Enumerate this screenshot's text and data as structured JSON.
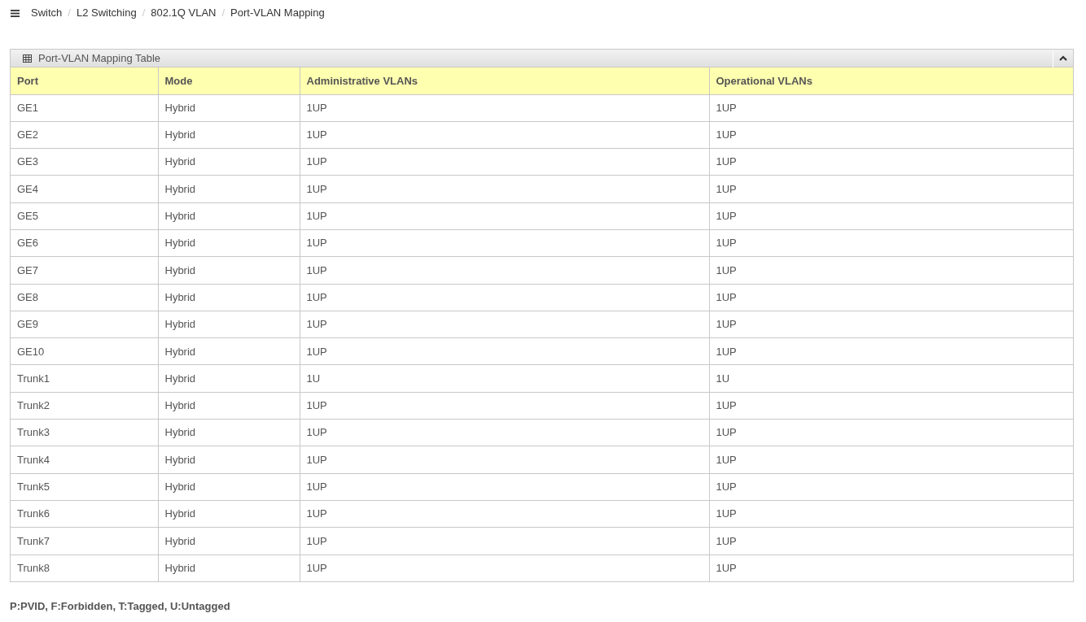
{
  "breadcrumb": [
    "Switch",
    "L2 Switching",
    "802.1Q VLAN",
    "Port-VLAN Mapping"
  ],
  "breadcrumb_separators": [
    "/",
    "/",
    "/"
  ],
  "panel": {
    "title": "Port-VLAN Mapping Table",
    "expanded": true
  },
  "table": {
    "columns": [
      "Port",
      "Mode",
      "Administrative VLANs",
      "Operational VLANs"
    ],
    "rows": [
      [
        "GE1",
        "Hybrid",
        "1UP",
        "1UP"
      ],
      [
        "GE2",
        "Hybrid",
        "1UP",
        "1UP"
      ],
      [
        "GE3",
        "Hybrid",
        "1UP",
        "1UP"
      ],
      [
        "GE4",
        "Hybrid",
        "1UP",
        "1UP"
      ],
      [
        "GE5",
        "Hybrid",
        "1UP",
        "1UP"
      ],
      [
        "GE6",
        "Hybrid",
        "1UP",
        "1UP"
      ],
      [
        "GE7",
        "Hybrid",
        "1UP",
        "1UP"
      ],
      [
        "GE8",
        "Hybrid",
        "1UP",
        "1UP"
      ],
      [
        "GE9",
        "Hybrid",
        "1UP",
        "1UP"
      ],
      [
        "GE10",
        "Hybrid",
        "1UP",
        "1UP"
      ],
      [
        "Trunk1",
        "Hybrid",
        "1U",
        "1U"
      ],
      [
        "Trunk2",
        "Hybrid",
        "1UP",
        "1UP"
      ],
      [
        "Trunk3",
        "Hybrid",
        "1UP",
        "1UP"
      ],
      [
        "Trunk4",
        "Hybrid",
        "1UP",
        "1UP"
      ],
      [
        "Trunk5",
        "Hybrid",
        "1UP",
        "1UP"
      ],
      [
        "Trunk6",
        "Hybrid",
        "1UP",
        "1UP"
      ],
      [
        "Trunk7",
        "Hybrid",
        "1UP",
        "1UP"
      ],
      [
        "Trunk8",
        "Hybrid",
        "1UP",
        "1UP"
      ]
    ]
  },
  "legend": "P:PVID, F:Forbidden, T:Tagged, U:Untagged"
}
